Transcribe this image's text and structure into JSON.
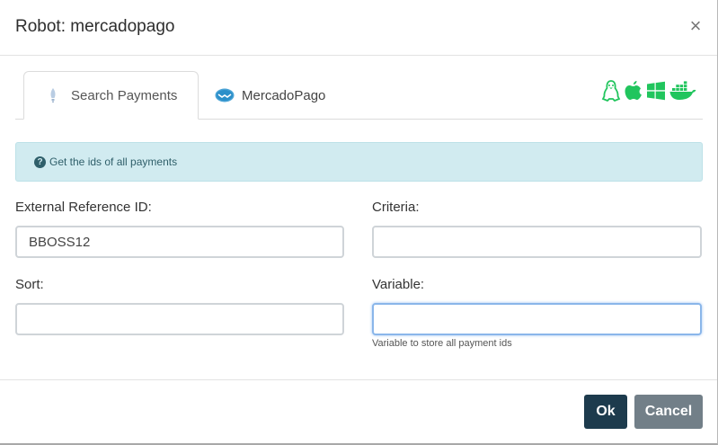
{
  "dialog": {
    "title": "Robot: mercadopago",
    "close_label": "×"
  },
  "tabs": [
    {
      "label": "Search Payments",
      "icon": "lightbulb-icon",
      "active": true
    },
    {
      "label": "MercadoPago",
      "icon": "mercadopago-logo-icon",
      "active": false
    }
  ],
  "platforms": {
    "color": "#21c55d",
    "icons": [
      "linux-icon",
      "apple-icon",
      "windows-icon",
      "docker-icon"
    ]
  },
  "alert": {
    "text": "Get the ids of all payments",
    "icon": "question-circle-icon"
  },
  "form": {
    "external_reference": {
      "label": "External Reference ID:",
      "value": "BBOSS12"
    },
    "criteria": {
      "label": "Criteria:",
      "value": ""
    },
    "sort": {
      "label": "Sort:",
      "value": ""
    },
    "variable": {
      "label": "Variable:",
      "value": "",
      "help": "Variable to store all payment ids"
    }
  },
  "buttons": {
    "ok": "Ok",
    "cancel": "Cancel"
  }
}
